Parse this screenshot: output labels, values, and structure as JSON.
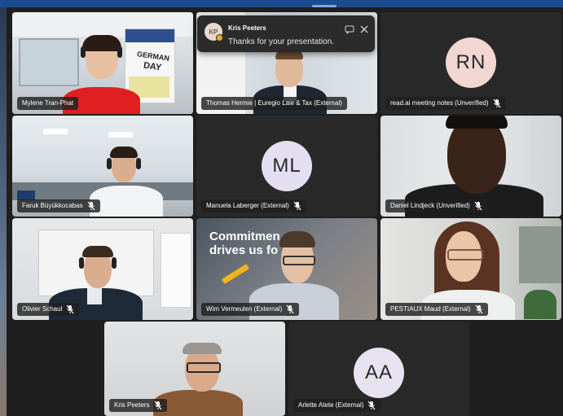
{
  "toast": {
    "sender_initials": "KP",
    "sender": "Kris Peeters",
    "message": "Thanks for your presentation.",
    "reply_icon": "reply-in-chat-icon",
    "close_icon": "close-icon"
  },
  "tiles": [
    {
      "name": "Mylene Tran-Phat",
      "muted": false
    },
    {
      "name": "Thomas Hermie | Euregio Law & Tax (External)",
      "muted": false
    },
    {
      "name": "read.ai meeting notes (Unverified)",
      "initials": "RN",
      "muted": true
    },
    {
      "name": "Faruk Büyükkocabas",
      "muted": true
    },
    {
      "name": "Manuela Laberger (External)",
      "initials": "ML",
      "muted": true
    },
    {
      "name": "Daniel Lindjeck (Unverified)",
      "muted": true
    },
    {
      "name": "Olivier Schaul",
      "muted": true
    },
    {
      "name": "Wim Vermeulen (External)",
      "muted": true
    },
    {
      "name": "PESTIAUX Maud (External)",
      "muted": true
    },
    {
      "name": "Kris Peeters",
      "muted": true
    },
    {
      "name": "Arlette Atete (External)",
      "initials": "AA",
      "muted": true
    }
  ],
  "wim_background_text": [
    "Commitmen",
    "drives us fo"
  ],
  "poster": {
    "line1": "GERMAN",
    "line2": "DAY"
  },
  "colors": {
    "tile_bg": "#292929",
    "avatar_rn": "#f2d6d2",
    "avatar_ml": "#e3dff0",
    "avatar_aa": "#e6e2ef",
    "accent": "#1b4c8f"
  }
}
